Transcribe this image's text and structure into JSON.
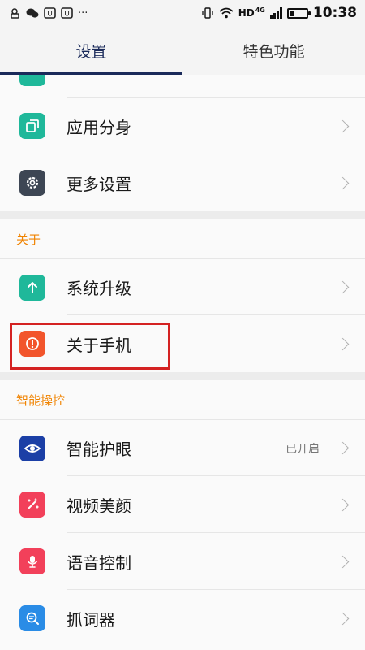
{
  "status": {
    "notif_icons": [
      "lock-person-icon",
      "wechat-icon",
      "app-badge-icon",
      "app-badge-icon"
    ],
    "more": "···",
    "network_label": "HD",
    "network_type": "4G",
    "time": "10:38"
  },
  "tabs": [
    {
      "label": "设置",
      "active": true
    },
    {
      "label": "特色功能",
      "active": false
    }
  ],
  "list": {
    "top_items": [
      {
        "label": "应用分身",
        "icon": "app-clone-icon",
        "color": "#1fb89a"
      },
      {
        "label": "更多设置",
        "icon": "gear-icon",
        "color": "#3d4654"
      }
    ],
    "about_section": {
      "title": "关于",
      "items": [
        {
          "label": "系统升级",
          "icon": "arrow-up-icon",
          "color": "#1fb89a"
        },
        {
          "label": "关于手机",
          "icon": "info-alert-icon",
          "color": "#f2552c"
        }
      ]
    },
    "smart_section": {
      "title": "智能操控",
      "items": [
        {
          "label": "智能护眼",
          "icon": "eye-icon",
          "color": "#1b3fa6",
          "value": "已开启"
        },
        {
          "label": "视频美颜",
          "icon": "magic-wand-icon",
          "color": "#f2405a"
        },
        {
          "label": "语音控制",
          "icon": "microphone-icon",
          "color": "#f2405a"
        },
        {
          "label": "抓词器",
          "icon": "word-search-icon",
          "color": "#2a8ce6"
        }
      ]
    }
  }
}
